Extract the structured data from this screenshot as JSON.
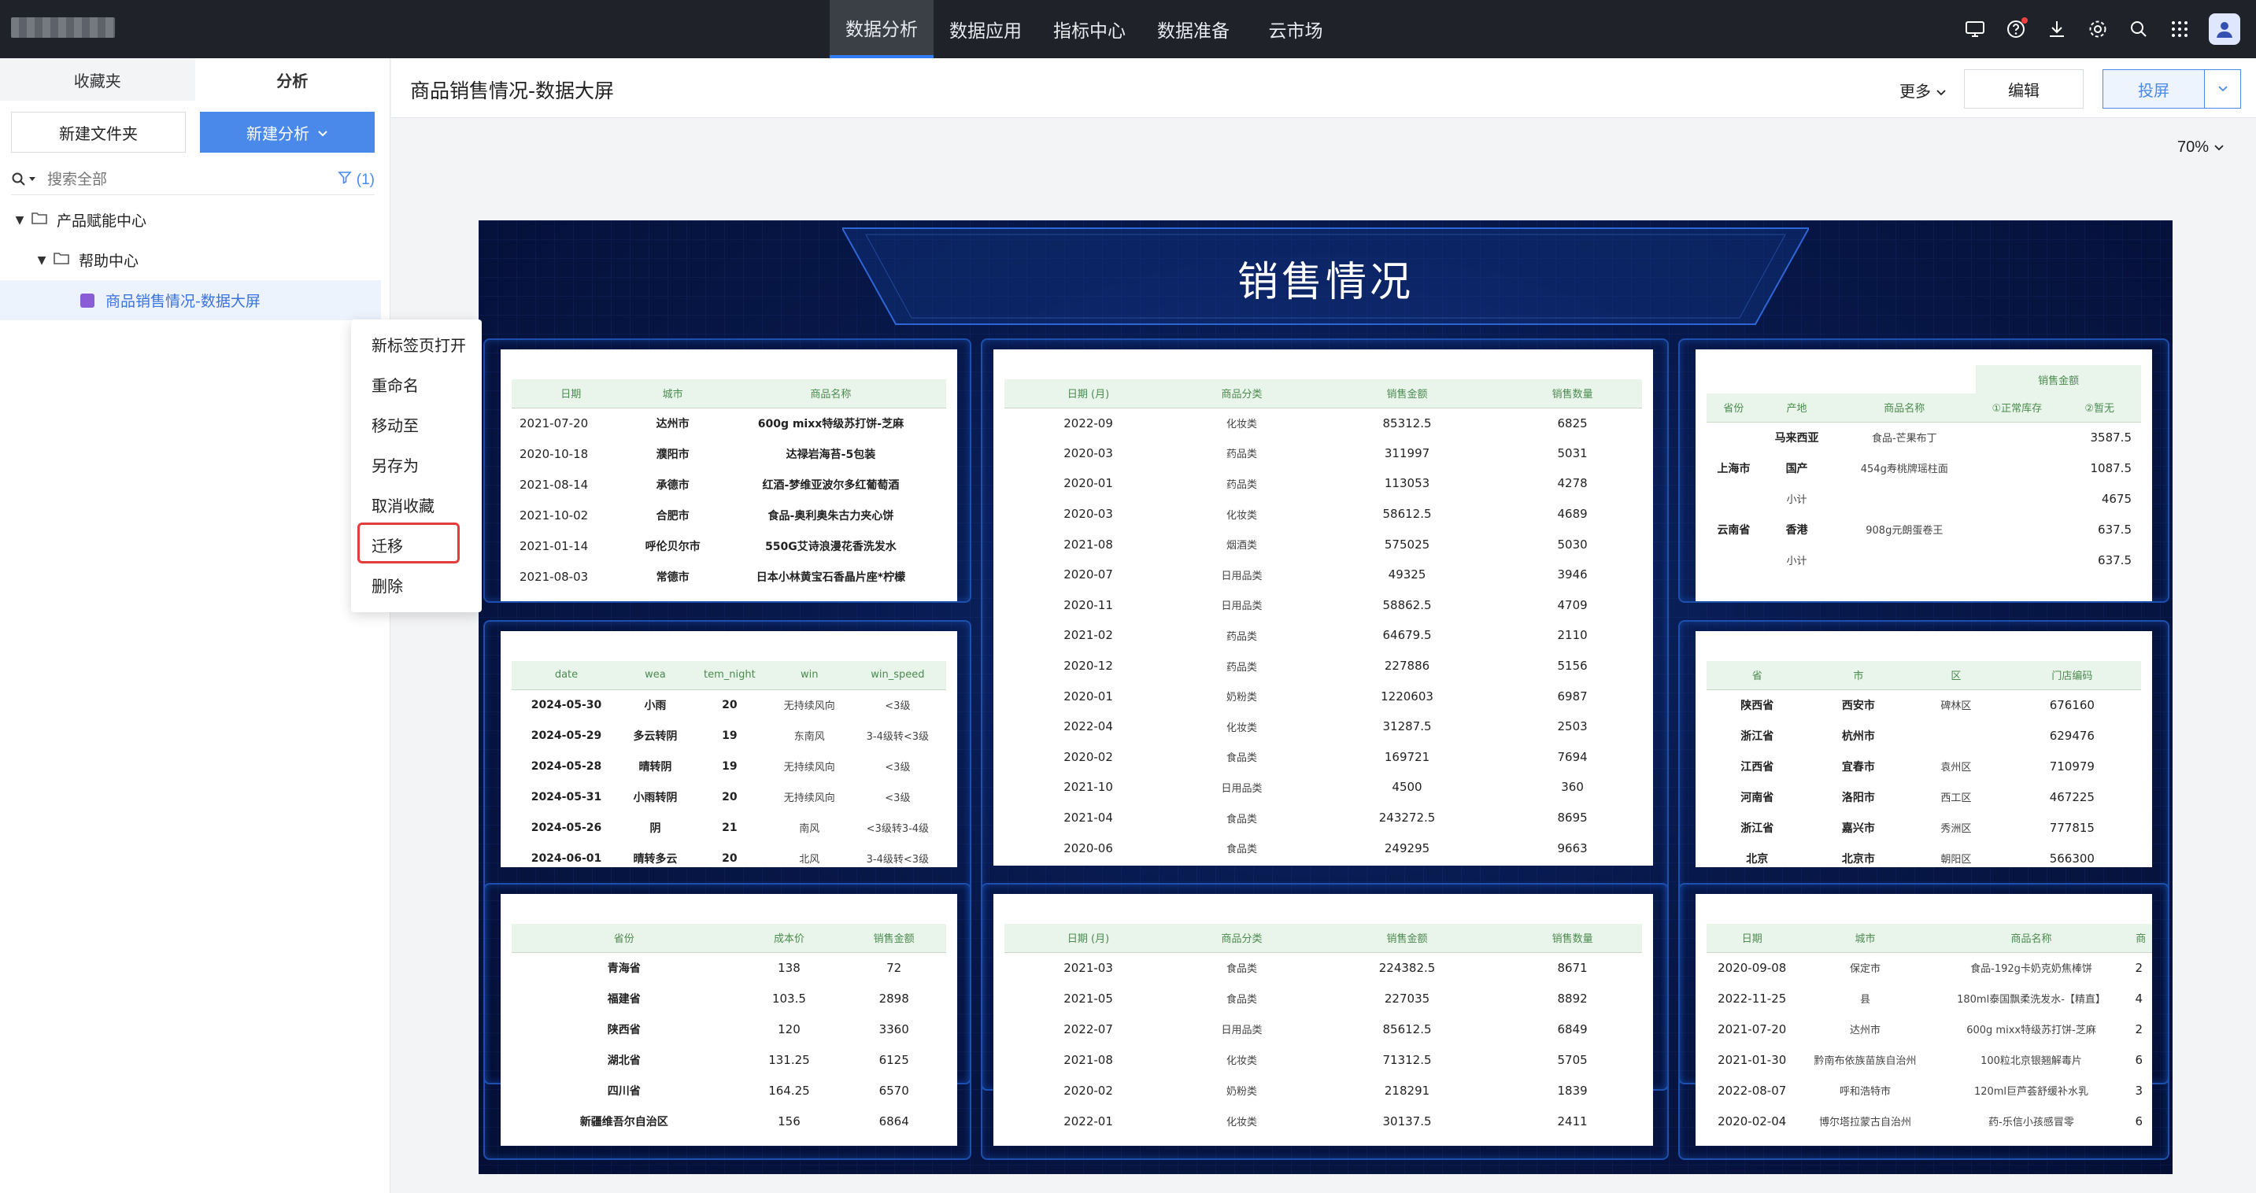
{
  "topnav": {
    "menu": [
      "数据分析",
      "数据应用",
      "指标中心",
      "数据准备",
      "云市场"
    ],
    "active_index": 0,
    "icons": [
      "screen-icon",
      "help-icon",
      "download-icon",
      "settings-icon",
      "search-icon",
      "apps-icon"
    ]
  },
  "sidebar": {
    "tabs": [
      "收藏夹",
      "分析"
    ],
    "active_tab": 1,
    "new_folder": "新建文件夹",
    "new_analysis": "新建分析",
    "search_placeholder": "搜索全部",
    "filter_label": "(1)",
    "tree": [
      {
        "label": "产品赋能中心",
        "level": 0
      },
      {
        "label": "帮助中心",
        "level": 1
      },
      {
        "label": "商品销售情况-数据大屏",
        "level": 2,
        "selected": true
      }
    ]
  },
  "context_menu": {
    "items": [
      "新标签页打开",
      "重命名",
      "移动至",
      "另存为",
      "取消收藏",
      "迁移",
      "删除"
    ],
    "highlighted_index": 5
  },
  "header": {
    "title": "商品销售情况-数据大屏",
    "more": "更多",
    "edit": "编辑",
    "present": "投屏",
    "zoom": "70%"
  },
  "dashboard": {
    "title": "销售情况",
    "t1": {
      "headers": [
        "日期",
        "城市",
        "商品名称"
      ],
      "rows": [
        [
          "2021-07-20",
          "达州市",
          "600g mixx特级苏打饼-芝麻"
        ],
        [
          "2020-10-18",
          "濮阳市",
          "达禄岩海苔-5包装"
        ],
        [
          "2021-08-14",
          "承德市",
          "红酒-梦维亚波尔多红葡萄酒"
        ],
        [
          "2021-10-02",
          "合肥市",
          "食品-奥利奥朱古力夹心饼"
        ],
        [
          "2021-01-14",
          "呼伦贝尔市",
          "550G艾诗浪漫花香洗发水"
        ],
        [
          "2021-08-03",
          "常德市",
          "日本小林黄宝石香晶片座*柠檬"
        ]
      ]
    },
    "t2": {
      "headers": [
        "日期 (月)",
        "商品分类",
        "销售金额",
        "销售数量"
      ],
      "rows": [
        [
          "2022-09",
          "化妆类",
          "85312.5",
          "6825"
        ],
        [
          "2020-03",
          "药品类",
          "311997",
          "5031"
        ],
        [
          "2020-01",
          "药品类",
          "113053",
          "4278"
        ],
        [
          "2020-03",
          "化妆类",
          "58612.5",
          "4689"
        ],
        [
          "2021-08",
          "烟酒类",
          "575025",
          "5030"
        ],
        [
          "2020-07",
          "日用品类",
          "49325",
          "3946"
        ],
        [
          "2020-11",
          "日用品类",
          "58862.5",
          "4709"
        ],
        [
          "2021-02",
          "药品类",
          "64679.5",
          "2110"
        ],
        [
          "2020-12",
          "药品类",
          "227886",
          "5156"
        ],
        [
          "2020-01",
          "奶粉类",
          "1220603",
          "6987"
        ],
        [
          "2022-04",
          "化妆类",
          "31287.5",
          "2503"
        ],
        [
          "2020-02",
          "食品类",
          "169721",
          "7694"
        ],
        [
          "2021-10",
          "日用品类",
          "4500",
          "360"
        ],
        [
          "2021-04",
          "食品类",
          "243272.5",
          "8695"
        ],
        [
          "2020-06",
          "食品类",
          "249295",
          "9663"
        ]
      ]
    },
    "t3": {
      "super_header": "销售金额",
      "headers": [
        "省份",
        "产地",
        "商品名称",
        "①正常库存",
        "②暂无"
      ],
      "rows": [
        [
          "",
          "马来西亚",
          "食品-芒果布丁",
          "",
          "3587.5"
        ],
        [
          "上海市",
          "国产",
          "454g寿桃牌瑶柱面",
          "",
          "1087.5"
        ],
        [
          "",
          "小计",
          "",
          "",
          "4675"
        ],
        [
          "云南省",
          "香港",
          "908g元朗蛋卷王",
          "",
          "637.5"
        ],
        [
          "",
          "小计",
          "",
          "",
          "637.5"
        ]
      ]
    },
    "t4": {
      "headers": [
        "date",
        "wea",
        "tem_night",
        "win",
        "win_speed"
      ],
      "rows": [
        [
          "2024-05-30",
          "小雨",
          "20",
          "无持续风向",
          "<3级"
        ],
        [
          "2024-05-29",
          "多云转阴",
          "19",
          "东南风",
          "3-4级转<3级"
        ],
        [
          "2024-05-28",
          "晴转阴",
          "19",
          "无持续风向",
          "<3级"
        ],
        [
          "2024-05-31",
          "小雨转阴",
          "20",
          "无持续风向",
          "<3级"
        ],
        [
          "2024-05-26",
          "阴",
          "21",
          "南风",
          "<3级转3-4级"
        ],
        [
          "2024-06-01",
          "晴转多云",
          "20",
          "北风",
          "3-4级转<3级"
        ]
      ]
    },
    "t5": {
      "headers": [
        "省",
        "市",
        "区",
        "门店编码"
      ],
      "rows": [
        [
          "陕西省",
          "西安市",
          "碑林区",
          "676160"
        ],
        [
          "浙江省",
          "杭州市",
          "",
          "629476"
        ],
        [
          "江西省",
          "宜春市",
          "袁州区",
          "710979"
        ],
        [
          "河南省",
          "洛阳市",
          "西工区",
          "467225"
        ],
        [
          "浙江省",
          "嘉兴市",
          "秀洲区",
          "777815"
        ],
        [
          "北京",
          "北京市",
          "朝阳区",
          "566300"
        ]
      ]
    },
    "t6": {
      "headers": [
        "省份",
        "成本价",
        "销售金额"
      ],
      "rows": [
        [
          "青海省",
          "138",
          "72"
        ],
        [
          "福建省",
          "103.5",
          "2898"
        ],
        [
          "陕西省",
          "120",
          "3360"
        ],
        [
          "湖北省",
          "131.25",
          "6125"
        ],
        [
          "四川省",
          "164.25",
          "6570"
        ],
        [
          "新疆维吾尔自治区",
          "156",
          "6864"
        ]
      ]
    },
    "t7": {
      "headers": [
        "日期 (月)",
        "商品分类",
        "销售金额",
        "销售数量"
      ],
      "rows": [
        [
          "2021-03",
          "食品类",
          "224382.5",
          "8671"
        ],
        [
          "2021-05",
          "食品类",
          "227035",
          "8892"
        ],
        [
          "2022-07",
          "日用品类",
          "85612.5",
          "6849"
        ],
        [
          "2021-08",
          "化妆类",
          "71312.5",
          "5705"
        ],
        [
          "2020-02",
          "奶粉类",
          "218291",
          "1839"
        ],
        [
          "2022-01",
          "化妆类",
          "30137.5",
          "2411"
        ]
      ]
    },
    "t8": {
      "headers": [
        "日期",
        "城市",
        "商品名称",
        "商"
      ],
      "rows": [
        [
          "2020-09-08",
          "保定市",
          "食品-192g卡奶克奶焦棒饼",
          "2"
        ],
        [
          "2022-11-25",
          "县",
          "180ml泰国飘柔洗发水-【精直】",
          "4"
        ],
        [
          "2021-07-20",
          "达州市",
          "600g mixx特级苏打饼-芝麻",
          "2"
        ],
        [
          "2021-01-30",
          "黔南布依族苗族自治州",
          "100粒北京银翘解毒片",
          "6"
        ],
        [
          "2022-08-07",
          "呼和浩特市",
          "120ml巨芦荟舒缓补水乳",
          "3"
        ],
        [
          "2020-02-04",
          "博尔塔拉蒙古自治州",
          "药-乐信小孩感冒零",
          "6"
        ]
      ]
    }
  }
}
